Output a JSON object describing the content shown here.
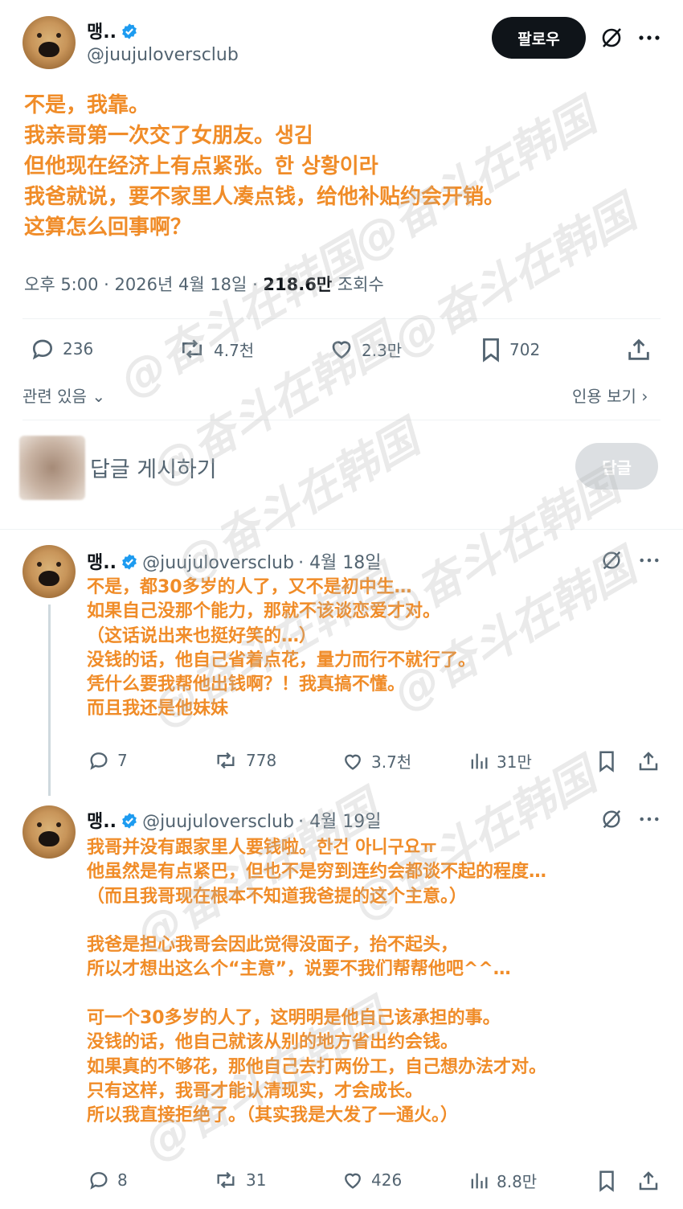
{
  "main": {
    "author_name": "맹..",
    "author_handle": "@juujuloversclub",
    "follow_label": "팔로우",
    "text_lines": [
      "不是，我靠。",
      "我亲哥第一次交了女朋友。생김",
      "但他现在经济上有点紧张。한 상황이라",
      "我爸就说，要不家里人凑点钱，给他补贴约会开销。",
      "这算怎么回事啊？"
    ],
    "time": "오후 5:00",
    "date": "2026년 4월 18일",
    "views_count": "218.6만",
    "views_label": "조회수",
    "replies": "236",
    "reposts": "4.7천",
    "likes": "2.3만",
    "bookmarks": "702",
    "related_label": "관련 있음",
    "quotes_label": "인용 보기"
  },
  "reply_box": {
    "placeholder": "답글 게시하기",
    "button": "답글"
  },
  "replies": [
    {
      "author_name": "맹..",
      "author_handle": "@juujuloversclub",
      "date": "4월 18일",
      "text_lines": [
        "不是，都30多岁的人了，又不是初中生…",
        "如果自己没那个能力，那就不该谈恋爱才对。",
        "（这话说出来也挺好笑的…）",
        "没钱的话，他自己省着点花，量力而行不就行了。",
        "凭什么要我帮他出钱啊？！我真搞不懂。",
        "而且我还是他妹妹"
      ],
      "replies": "7",
      "reposts": "778",
      "likes": "3.7천",
      "views": "31만"
    },
    {
      "author_name": "맹..",
      "author_handle": "@juujuloversclub",
      "date": "4월 19일",
      "text_lines": [
        "我哥并没有跟家里人要钱啦。한건 아니구요ㅠ",
        "他虽然是有点紧巴，但也不是穷到连约会都谈不起的程度…",
        "（而且我哥现在根本不知道我爸提的这个主意。）",
        "",
        "我爸是担心我哥会因此觉得没面子，抬不起头，",
        "所以才想出这么个“主意”，说要不我们帮帮他吧^^…",
        "",
        "可一个30多岁的人了，这明明是他自己该承担的事。",
        "没钱的话，他自己就该从别的地方省出约会钱。",
        "如果真的不够花，那他自己去打两份工，自己想办法才对。",
        "只有这样，我哥才能认清现实，才会成长。",
        "所以我直接拒绝了。（其实我是大发了一通火。）"
      ],
      "replies": "8",
      "reposts": "31",
      "likes": "426",
      "views": "8.8만"
    }
  ],
  "watermark": "@奋斗在韩国",
  "colors": {
    "accent_text": "#f08c28",
    "verified": "#1d9bf0",
    "follow_bg": "#0f1419",
    "muted": "#536471"
  }
}
